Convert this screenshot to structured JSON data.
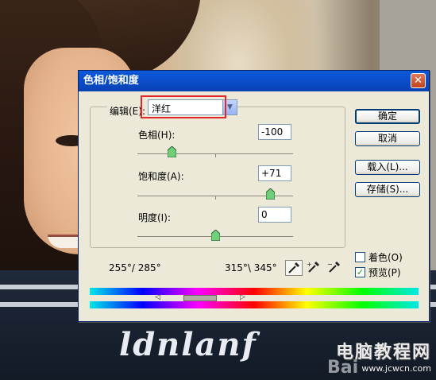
{
  "dialog": {
    "title": "色相/饱和度",
    "edit_label": "编辑(E):",
    "edit_value": "洋红",
    "hue_label": "色相(H):",
    "hue_value": "-100",
    "hue_level": -100,
    "saturation_label": "饱和度(A):",
    "saturation_value": "+71",
    "saturation_level": 71,
    "lightness_label": "明度(I):",
    "lightness_value": "0",
    "lightness_level": 0,
    "buttons": {
      "ok": "确定",
      "cancel": "取消",
      "load": "载入(L)...",
      "save": "存储(S)..."
    },
    "colorize_label": "着色(O)",
    "colorize_checked": false,
    "preview_label": "预览(P)",
    "preview_checked": true,
    "range_left": "255°/ 285°",
    "range_right": "315°\\ 345°"
  },
  "watermark": {
    "main": "电脑教程网",
    "url": "www.jcwcn.com",
    "baidu": "Bai"
  },
  "colors": {
    "titlebar": "#0a4fcf",
    "highlight": "#e0262b",
    "dialog_bg": "#ece9d8"
  },
  "icons": [
    "close-icon",
    "dropdown-arrow-icon",
    "eyedropper-icon",
    "eyedropper-plus-icon",
    "eyedropper-minus-icon",
    "checkmark-icon"
  ]
}
